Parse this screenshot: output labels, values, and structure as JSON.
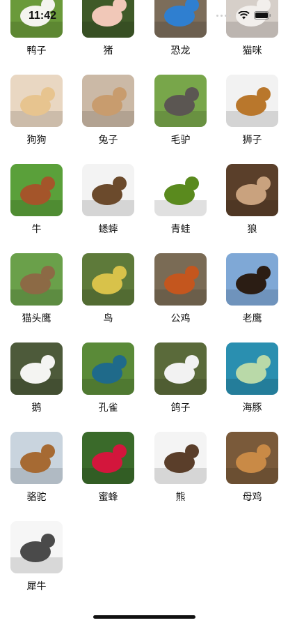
{
  "status_bar": {
    "time": "11:42"
  },
  "animals": [
    {
      "name": "鸭子",
      "icon": "duck-photo",
      "bg": "#6a9a3a",
      "fg": "#f4f4ef"
    },
    {
      "name": "猪",
      "icon": "pig-photo",
      "bg": "#3f5a28",
      "fg": "#f1c8b8"
    },
    {
      "name": "恐龙",
      "icon": "dinosaur-toy-photo",
      "bg": "#7c6d5a",
      "fg": "#2f7fd0"
    },
    {
      "name": "猫咪",
      "icon": "cat-photo",
      "bg": "#d6cfc9",
      "fg": "#f2efec"
    },
    {
      "name": "狗狗",
      "icon": "dog-photo",
      "bg": "#e9d7c2",
      "fg": "#e7c48f"
    },
    {
      "name": "兔子",
      "icon": "rabbit-photo",
      "bg": "#cbb9a6",
      "fg": "#c89c6e"
    },
    {
      "name": "毛驴",
      "icon": "donkey-photo",
      "bg": "#78a64a",
      "fg": "#5b5652"
    },
    {
      "name": "狮子",
      "icon": "lion-photo",
      "bg": "#f2f2f2",
      "fg": "#b9772c"
    },
    {
      "name": "牛",
      "icon": "cow-photo",
      "bg": "#5aa03a",
      "fg": "#a4552a"
    },
    {
      "name": "蟋蟀",
      "icon": "cricket-photo",
      "bg": "#f3f3f3",
      "fg": "#6b4a2c"
    },
    {
      "name": "青蛙",
      "icon": "frog-photo",
      "bg": "#ffffff",
      "fg": "#5a8a1e"
    },
    {
      "name": "狼",
      "icon": "wolf-photo",
      "bg": "#5a3f2a",
      "fg": "#c9a27e"
    },
    {
      "name": "猫头鹰",
      "icon": "owl-photo",
      "bg": "#6aa04a",
      "fg": "#8c6a45"
    },
    {
      "name": "鸟",
      "icon": "birds-photo",
      "bg": "#5e7a3a",
      "fg": "#d8c24a"
    },
    {
      "name": "公鸡",
      "icon": "rooster-photo",
      "bg": "#7a6b55",
      "fg": "#c4561e"
    },
    {
      "name": "老鹰",
      "icon": "eagle-photo",
      "bg": "#7fa8d6",
      "fg": "#2b1d14"
    },
    {
      "name": "鹅",
      "icon": "geese-photo",
      "bg": "#4d5a3a",
      "fg": "#f4f4f2"
    },
    {
      "name": "孔雀",
      "icon": "peacock-photo",
      "bg": "#5a8a38",
      "fg": "#1f6a8a"
    },
    {
      "name": "鸽子",
      "icon": "dove-photo",
      "bg": "#5a6a3a",
      "fg": "#f2f2f2"
    },
    {
      "name": "海豚",
      "icon": "dolphin-photo",
      "bg": "#2a8fb0",
      "fg": "#b9d9a8"
    },
    {
      "name": "骆驼",
      "icon": "camel-photo",
      "bg": "#c9d4de",
      "fg": "#a66a33"
    },
    {
      "name": "蜜蜂",
      "icon": "bee-photo",
      "bg": "#3a6a2a",
      "fg": "#d3163c"
    },
    {
      "name": "熊",
      "icon": "bear-photo",
      "bg": "#f4f4f4",
      "fg": "#5a3e2a"
    },
    {
      "name": "母鸡",
      "icon": "hens-photo",
      "bg": "#7a5a3a",
      "fg": "#c98a46"
    },
    {
      "name": "犀牛",
      "icon": "rhino-photo",
      "bg": "#f6f6f6",
      "fg": "#4a4a4a"
    }
  ]
}
